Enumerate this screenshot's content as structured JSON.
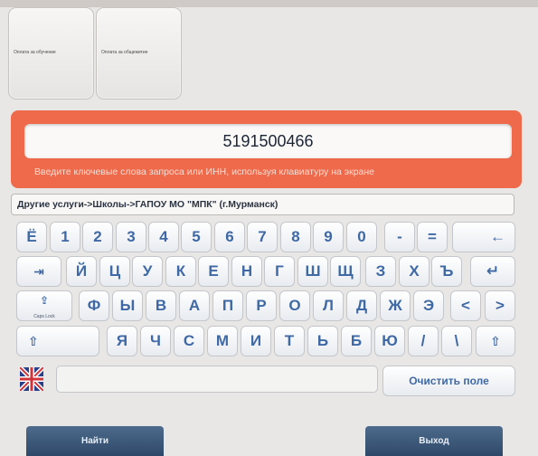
{
  "tiles": [
    {
      "label": "Оплата за обучение"
    },
    {
      "label": "Оплата за общежитие"
    }
  ],
  "search": {
    "value": "5191500466",
    "hint": "Введите ключевые слова запроса или ИНН, используя клавиатуру на экране"
  },
  "breadcrumb": "Другие услуги->Школы->ГАПОУ МО \"МПК\" (г.Мурманск)",
  "keyboard": {
    "row1": [
      "Ё",
      "1",
      "2",
      "3",
      "4",
      "5",
      "6",
      "7",
      "8",
      "9",
      "0",
      "-",
      "=",
      "←"
    ],
    "row2": [
      "⇥",
      "Й",
      "Ц",
      "У",
      "К",
      "Е",
      "Н",
      "Г",
      "Ш",
      "Щ",
      "З",
      "Х",
      "Ъ",
      "↵"
    ],
    "row3": [
      "⇪",
      "Ф",
      "Ы",
      "В",
      "А",
      "П",
      "Р",
      "О",
      "Л",
      "Д",
      "Ж",
      "Э",
      "<",
      ">"
    ],
    "row4": [
      "⇧",
      "Я",
      "Ч",
      "С",
      "М",
      "И",
      "Т",
      "Ь",
      "Б",
      "Ю",
      "/",
      "\\",
      "⇧"
    ],
    "caps_lock_label": "Caps Lock",
    "clear_label": "Очистить поле",
    "language_icon": "uk-flag-icon"
  },
  "buttons": {
    "find": "Найти",
    "exit": "Выход"
  },
  "colors": {
    "accent": "#ef6a4b",
    "key_text": "#3f69a5",
    "nav_button": "#3a5678"
  }
}
